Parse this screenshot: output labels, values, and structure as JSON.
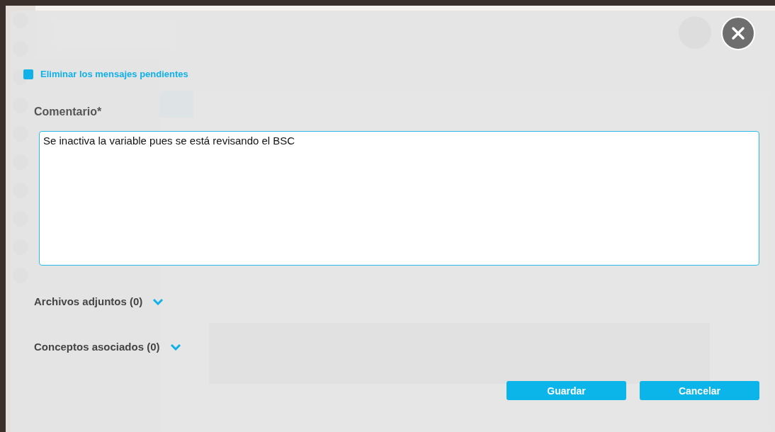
{
  "dialog": {
    "delete_pending": {
      "label": "Eliminar los mensajes pendientes",
      "checked": true
    },
    "comment": {
      "label": "Comentario*",
      "value": "Se inactiva la variable pues se está revisando el BSC"
    },
    "sections": [
      {
        "label": "Archivos adjuntos (0)",
        "expanded": false
      },
      {
        "label": "Conceptos asociados (0)",
        "expanded": false
      }
    ],
    "buttons": [
      "Guardar",
      "Cancelar"
    ]
  }
}
